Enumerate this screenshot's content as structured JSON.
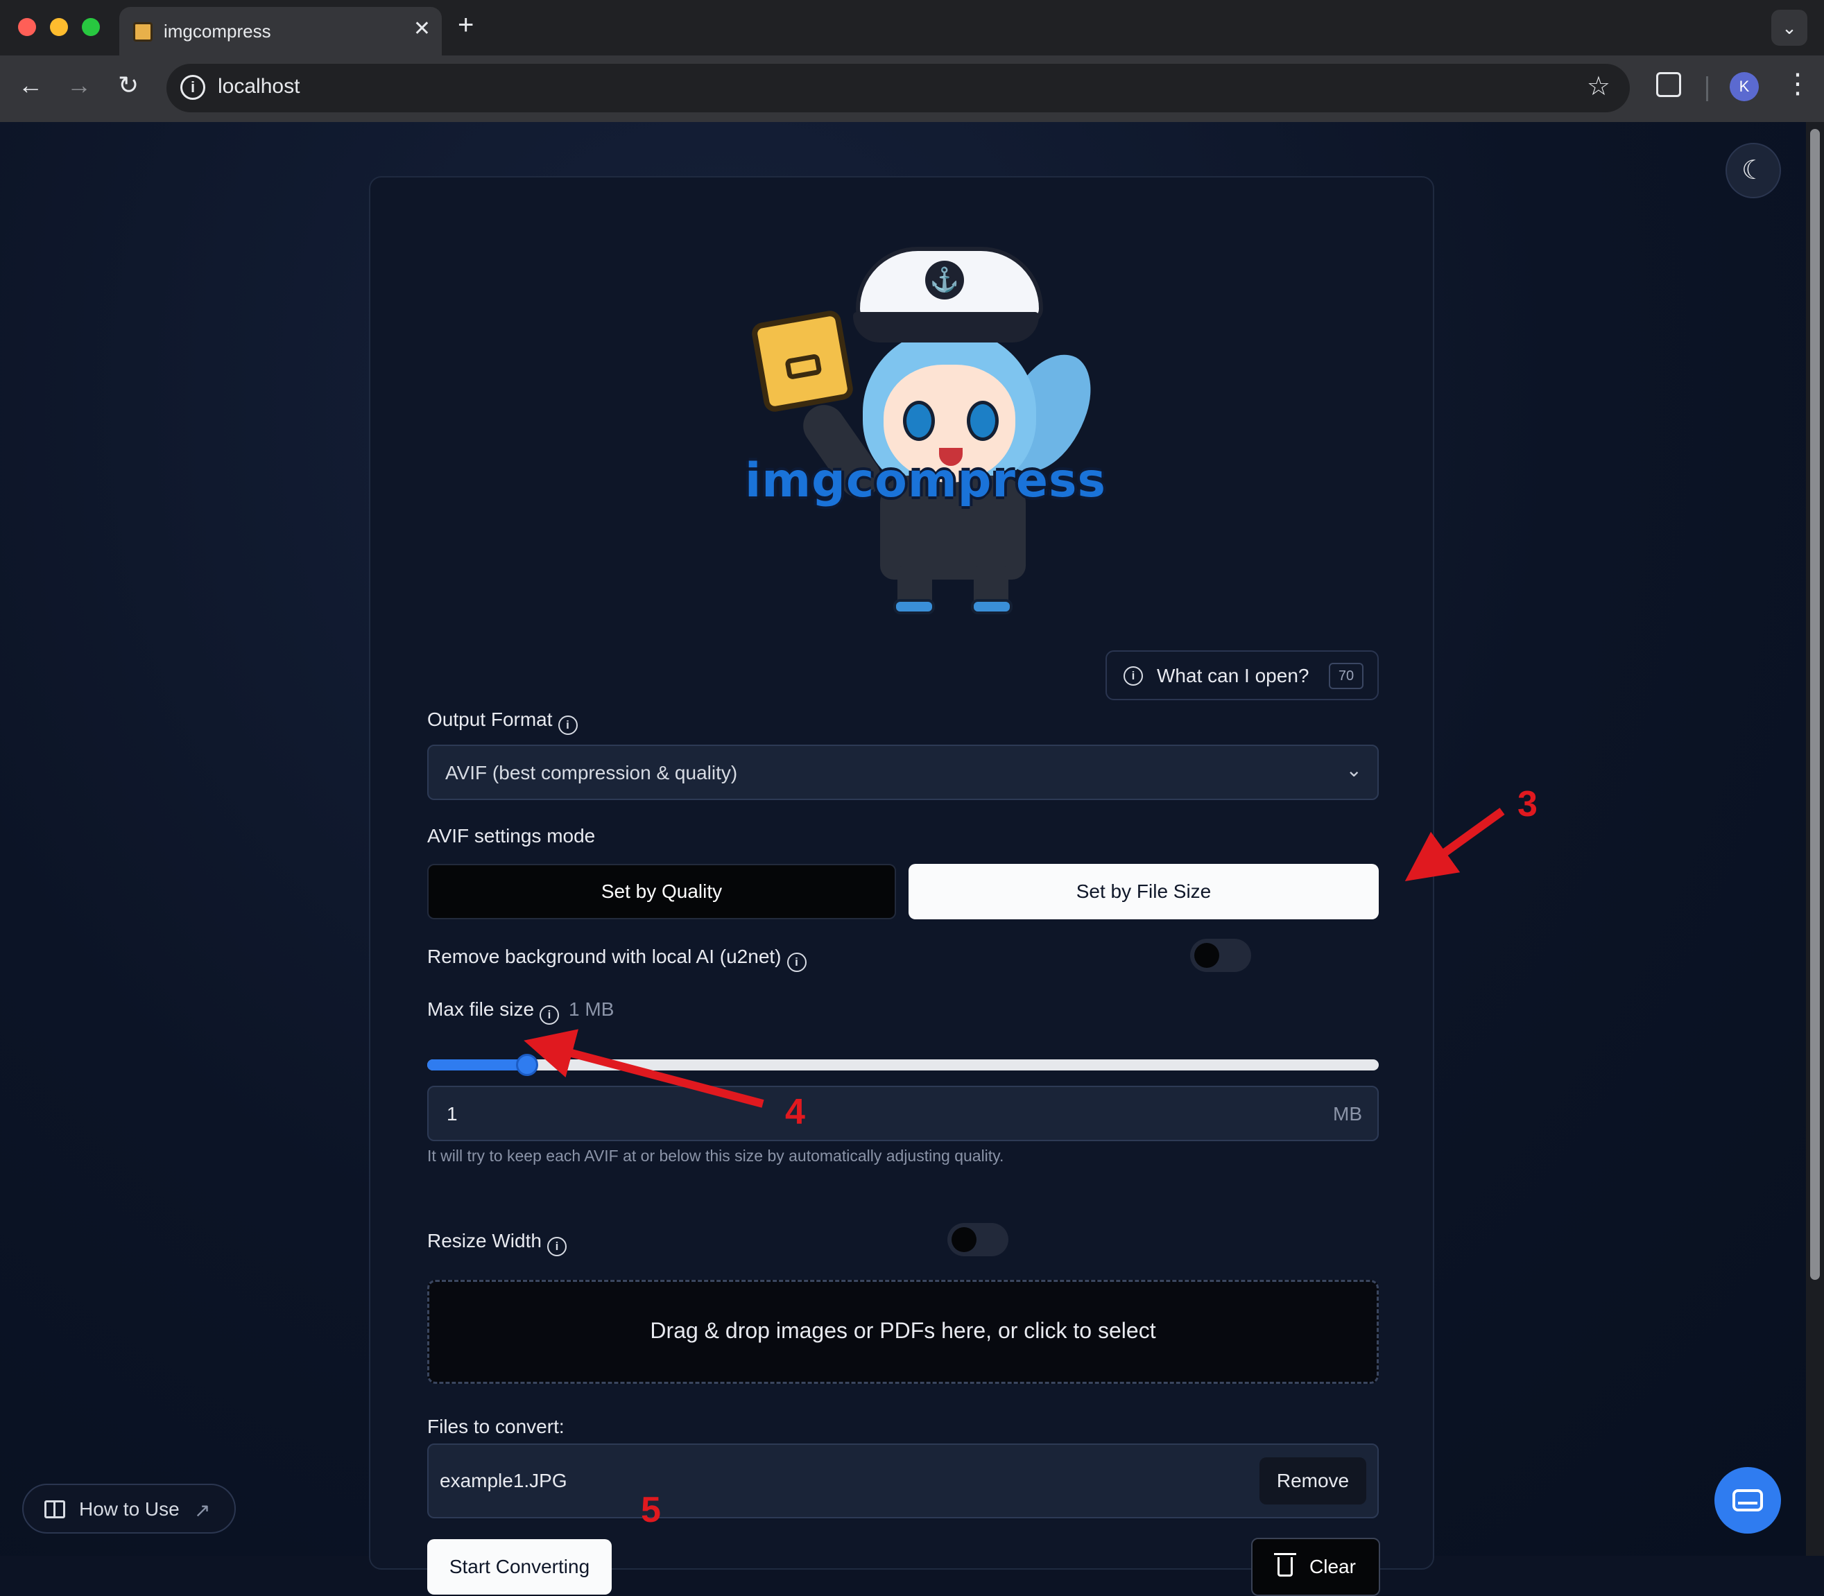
{
  "browser": {
    "tab_title": "imgcompress",
    "tab_close": "✕",
    "new_tab": "+",
    "tab_search": "⌄",
    "url": "localhost",
    "back": "←",
    "forward": "→",
    "reload": "↻",
    "bookmark": "☆",
    "profile_initial": "K",
    "menu": "⋮"
  },
  "app": {
    "logo_text": "imgcompress",
    "theme_toggle_icon": "moon-icon",
    "what_can_i_open": {
      "label": "What can I open?",
      "badge": "70"
    },
    "output_format": {
      "label": "Output Format",
      "selected": "AVIF (best compression & quality)"
    },
    "avif_mode": {
      "label": "AVIF settings mode",
      "options": [
        "Set by Quality",
        "Set by File Size"
      ],
      "selected": "Set by File Size"
    },
    "remove_background": {
      "label": "Remove background with local AI (u2net)",
      "enabled": false
    },
    "max_file_size": {
      "label": "Max file size",
      "display": "1 MB",
      "slider_fraction": 0.105,
      "input_value": "1",
      "unit": "MB",
      "hint": "It will try to keep each AVIF at or below this size by automatically adjusting quality."
    },
    "resize_width": {
      "label": "Resize Width",
      "enabled": false
    },
    "dropzone": {
      "text": "Drag & drop images or PDFs here, or click to select"
    },
    "files": {
      "label": "Files to convert:",
      "items": [
        {
          "name": "example1.JPG",
          "remove_label": "Remove"
        }
      ]
    },
    "start_label": "Start Converting",
    "clear_label": "Clear",
    "how_to_use": "How to Use"
  },
  "annotations": {
    "three": "3",
    "four": "4",
    "five": "5",
    "color": "#e0191f"
  },
  "colors": {
    "accent": "#2f7cf0",
    "logo": "#1a73d9",
    "background": "#0c1324"
  }
}
